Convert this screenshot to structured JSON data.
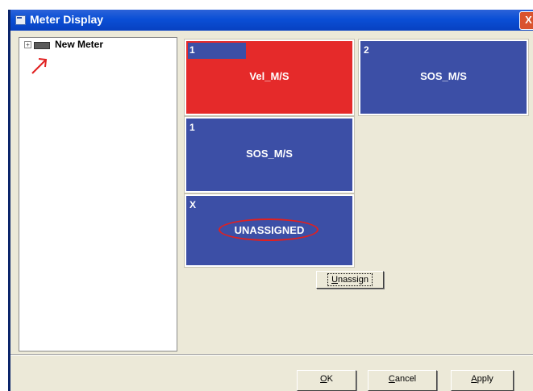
{
  "window": {
    "title": "Meter Display",
    "close_label": "X"
  },
  "tree": {
    "expander": "+",
    "items": [
      {
        "label": "New Meter"
      }
    ]
  },
  "tiles": [
    {
      "number": "1",
      "label": "Vel_M/S",
      "color": "#e52a2a",
      "selected": true
    },
    {
      "number": "2",
      "label": "SOS_M/S",
      "color": "#3c4fa6"
    },
    {
      "number": "1",
      "label": "SOS_M/S",
      "color": "#3c4fa6"
    },
    {
      "number": "X",
      "label": "UNASSIGNED",
      "color": "#3c4fa6"
    }
  ],
  "buttons": {
    "unassign": {
      "accel": "U",
      "rest": "nassign"
    },
    "ok": {
      "accel": "O",
      "rest": "K"
    },
    "cancel": {
      "accel": "C",
      "rest": "ancel"
    },
    "apply": {
      "accel": "A",
      "rest": "pply"
    }
  },
  "annotations": {
    "arrow_color": "#e02020",
    "highlight_color": "#e02020"
  }
}
